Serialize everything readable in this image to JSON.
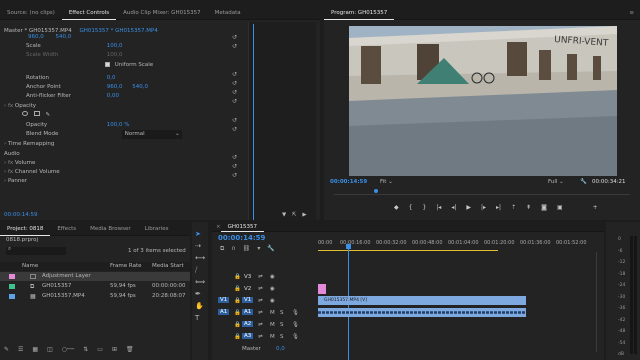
{
  "effect_controls": {
    "tabs": [
      "Source: (no clips)",
      "Effect Controls",
      "Audio Clip Mixer: GH015357",
      "Metadata"
    ],
    "header_master": "Master * GH015357.MP4",
    "header_clip": "GH015357 * GH015357.MP4",
    "position_values": [
      "960,0",
      "540,0"
    ],
    "scale_label": "Scale",
    "scale_value": "100,0",
    "scale_width_label": "Scale Width",
    "scale_width_value": "100,0",
    "uniform_scale_label": "Uniform Scale",
    "rotation_label": "Rotation",
    "rotation_value": "0,0",
    "anchor_label": "Anchor Point",
    "anchor_x": "960,0",
    "anchor_y": "540,0",
    "antiflicker_label": "Anti-flicker Filter",
    "antiflicker_value": "0,00",
    "opacity_section": "Opacity",
    "opacity_label": "Opacity",
    "opacity_value": "100,0 %",
    "blend_label": "Blend Mode",
    "blend_value": "Normal",
    "time_remapping": "Time Remapping",
    "audio_section": "Audio",
    "volume_label": "Volume",
    "channel_volume_label": "Channel Volume",
    "panner_label": "Panner",
    "timecode": "00:00:14:59"
  },
  "program": {
    "title": "Program: GH015357",
    "timecode": "00:00:14:59",
    "fit": "Fit",
    "quality": "Full",
    "duration": "00:00:34:21",
    "sign_text": "UNFRI-VENT"
  },
  "project": {
    "tabs": [
      "Project: 0818",
      "Effects",
      "Media Browser",
      "Libraries"
    ],
    "filename": "0818.prproj",
    "selection_count": "1 of 3 items selected",
    "columns": [
      "Name",
      "Frame Rate",
      "Media Start"
    ],
    "items": [
      {
        "name": "Adjustment Layer",
        "rate": "",
        "start": "",
        "color": "#e38bd8"
      },
      {
        "name": "GH015357",
        "rate": "59,94 fps",
        "start": "00:00:00:00",
        "color": "#3ec18e"
      },
      {
        "name": "GH015357.MP4",
        "rate": "59,94 fps",
        "start": "20:28:08:07",
        "color": "#5ba3e6"
      }
    ]
  },
  "timeline": {
    "tab": "GH015357",
    "timecode": "00:00:14:59",
    "ruler": [
      "00:00",
      "00:00:16:00",
      "00:00:32:00",
      "00:00:48:00",
      "00:01:04:00",
      "00:01:20:00",
      "00:01:36:00",
      "00:01:52:00"
    ],
    "video_tracks": [
      "V3",
      "V2",
      "V1"
    ],
    "audio_tracks": [
      "A1",
      "A2",
      "A3"
    ],
    "source_patch": [
      "V1",
      "A1"
    ],
    "master_label": "Master",
    "master_value": "0,0",
    "clip_label": "GH015357.MP4 [V]"
  },
  "meter_labels": [
    "0",
    "-6",
    "-12",
    "-18",
    "-24",
    "-30",
    "-36",
    "-42",
    "-48",
    "-54",
    "dB"
  ],
  "colors": {
    "accent": "#3a8fe8",
    "clip_video": "#7ea8e0",
    "clip_audio": "#7ea8e0",
    "adjustment": "#e38bd8"
  }
}
